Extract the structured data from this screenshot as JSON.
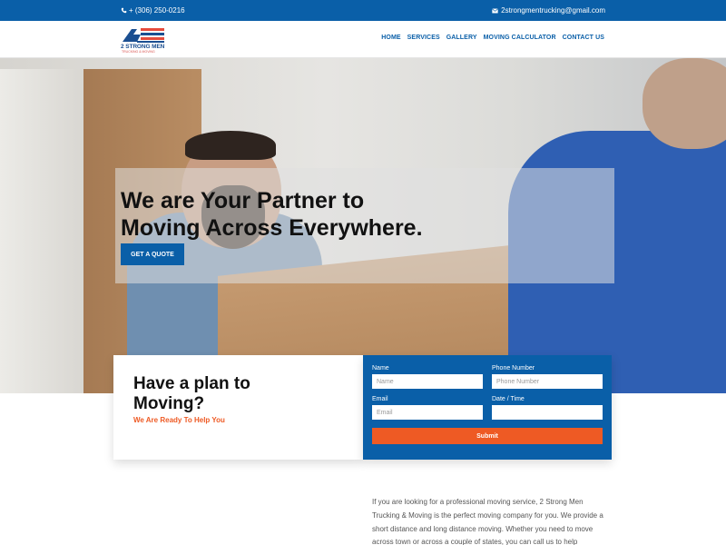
{
  "topbar": {
    "phone": "+ (306) 250-0216",
    "email": "2strongmentrucking@gmail.com",
    "bg_color": "#0a5fa8"
  },
  "logo": {
    "name": "2 STRONG MEN",
    "tagline": "TRUCKING & MOVING"
  },
  "nav": {
    "items": [
      {
        "label": "HOME"
      },
      {
        "label": "SERVICES"
      },
      {
        "label": "GALLERY"
      },
      {
        "label": "MOVING CALCULATOR"
      },
      {
        "label": "CONTACT US"
      }
    ]
  },
  "hero": {
    "title_line1": "We are Your Partner to",
    "title_line2": "Moving Across Everywhere.",
    "cta_label": "GET A QUOTE"
  },
  "plan": {
    "title": "Have a plan to Moving?",
    "subtitle": "We Are Ready To Help You"
  },
  "form": {
    "name_label": "Name",
    "name_placeholder": "Name",
    "phone_label": "Phone Number",
    "phone_placeholder": "Phone Number",
    "email_label": "Email",
    "email_placeholder": "Email",
    "datetime_label": "Date / Time",
    "datetime_placeholder": "",
    "submit_label": "Submit"
  },
  "intro": {
    "text": "If you are looking for a professional moving service, 2 Strong Men Trucking & Moving is the perfect moving company for you. We provide a short distance and long distance moving. Whether you need to move across town or across a couple of states, you can call us to help"
  },
  "colors": {
    "primary": "#0a5fa8",
    "accent": "#ee5a24"
  }
}
